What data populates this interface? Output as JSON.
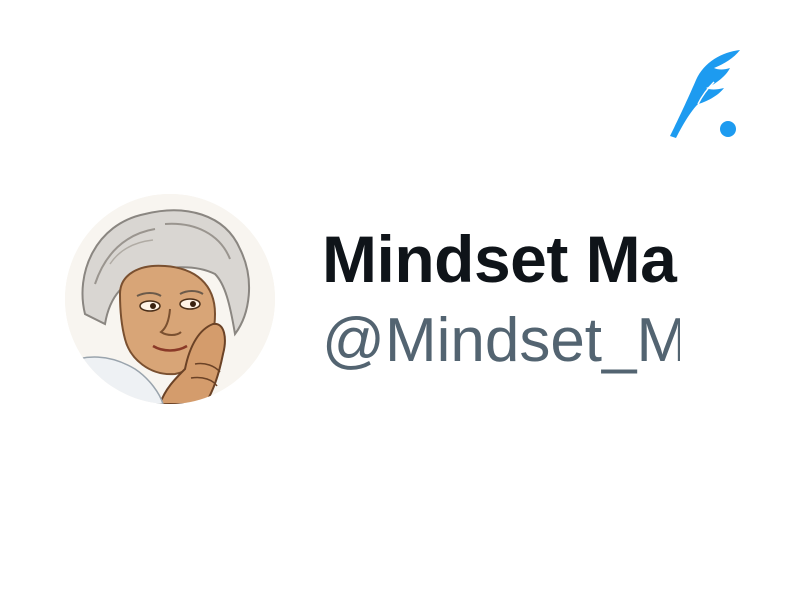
{
  "profile": {
    "display_name": "Mindset Ma",
    "handle": "@Mindset_M",
    "avatar": "portrait-avatar"
  },
  "brand": {
    "icon": "quill-logo-icon",
    "color": "#1d9bf0"
  },
  "colors": {
    "name_text": "#0f1419",
    "handle_text": "#536471",
    "background": "#ffffff"
  }
}
